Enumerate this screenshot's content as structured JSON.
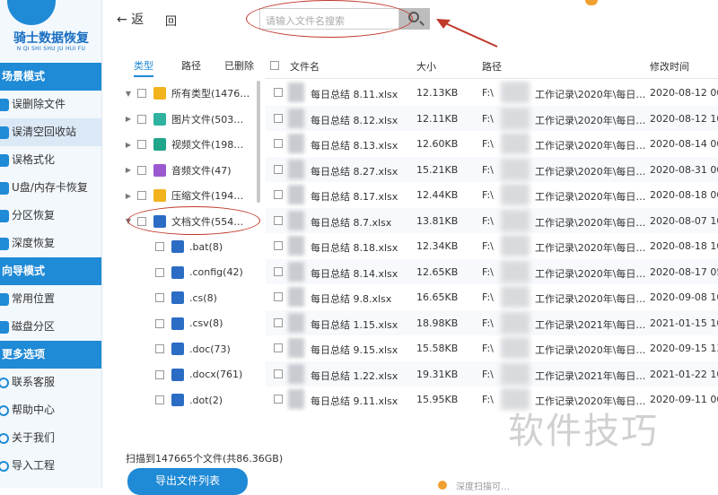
{
  "sidebar": {
    "app_title": "骑士数据恢复",
    "app_subtitle": "N QI SHI SHU JU HUI FU",
    "sections": [
      {
        "title": "场景模式",
        "items": [
          "误删除文件",
          "误清空回收站",
          "误格式化",
          "U盘/内存卡恢复",
          "分区恢复",
          "深度恢复"
        ]
      },
      {
        "title": "向导模式",
        "items": [
          "常用位置",
          "磁盘分区"
        ]
      },
      {
        "title": "更多选项",
        "items": [
          "联系客服",
          "帮助中心",
          "关于我们",
          "导入工程"
        ]
      }
    ]
  },
  "topbar": {
    "back_label": "← 返",
    "home_label": "回",
    "search_placeholder": "请输入文件名搜索"
  },
  "tree": {
    "tabs": [
      "类型",
      "路径",
      "已删除"
    ],
    "rows": [
      {
        "label": "所有类型(1476…",
        "color": "#f3b31f"
      },
      {
        "label": "图片文件(503…",
        "color": "#2fb3a0"
      },
      {
        "label": "视频文件(198…",
        "color": "#1fa68a"
      },
      {
        "label": "音频文件(47)",
        "color": "#9b59d0"
      },
      {
        "label": "压缩文件(194…",
        "color": "#f3b31f"
      },
      {
        "label": "文档文件(554…",
        "color": "#2b6cc4"
      },
      {
        "label": ".bat(8)",
        "color": "#2b6cc4"
      },
      {
        "label": ".config(42)",
        "color": "#2b6cc4"
      },
      {
        "label": ".cs(8)",
        "color": "#2b6cc4"
      },
      {
        "label": ".csv(8)",
        "color": "#2b6cc4"
      },
      {
        "label": ".doc(73)",
        "color": "#2b6cc4"
      },
      {
        "label": ".docx(761)",
        "color": "#2b6cc4"
      },
      {
        "label": ".dot(2)",
        "color": "#2b6cc4"
      }
    ],
    "scan_info": "扫描到147665个文件(共86.36GB)",
    "export_label": "导出文件列表"
  },
  "table": {
    "headers": {
      "name": "文件名",
      "size": "大小",
      "path": "路径",
      "modified": "修改时间"
    },
    "rows": [
      {
        "name": "每日总结 8.11.xlsx",
        "size": "12.13KB",
        "path": "工作记录\\2020年\\每日…",
        "time": "2020-08-12 00"
      },
      {
        "name": "每日总结 8.12.xlsx",
        "size": "12.11KB",
        "path": "工作记录\\2020年\\每日…",
        "time": "2020-08-12 10"
      },
      {
        "name": "每日总结 8.13.xlsx",
        "size": "12.60KB",
        "path": "工作记录\\2020年\\每日…",
        "time": "2020-08-14 00"
      },
      {
        "name": "每日总结 8.27.xlsx",
        "size": "15.21KB",
        "path": "工作记录\\2020年\\每日…",
        "time": "2020-08-31 00"
      },
      {
        "name": "每日总结 8.17.xlsx",
        "size": "12.44KB",
        "path": "工作记录\\2020年\\每日…",
        "time": "2020-08-18 00"
      },
      {
        "name": "每日总结 8.7.xlsx",
        "size": "13.81KB",
        "path": "工作记录\\2020年\\每日…",
        "time": "2020-08-07 10"
      },
      {
        "name": "每日总结 8.18.xlsx",
        "size": "12.34KB",
        "path": "工作记录\\2020年\\每日…",
        "time": "2020-08-18 10"
      },
      {
        "name": "每日总结 8.14.xlsx",
        "size": "12.65KB",
        "path": "工作记录\\2020年\\每日…",
        "time": "2020-08-17 05"
      },
      {
        "name": "每日总结 9.8.xlsx",
        "size": "16.65KB",
        "path": "工作记录\\2020年\\每日…",
        "time": "2020-09-08 10"
      },
      {
        "name": "每日总结 1.15.xlsx",
        "size": "18.98KB",
        "path": "工作记录\\2021年\\每日…",
        "time": "2021-01-15 10"
      },
      {
        "name": "每日总结 9.15.xlsx",
        "size": "15.58KB",
        "path": "工作记录\\2020年\\每日…",
        "time": "2020-09-15 13"
      },
      {
        "name": "每日总结 1.22.xlsx",
        "size": "19.31KB",
        "path": "工作记录\\2021年\\每日…",
        "time": "2021-01-22 10"
      },
      {
        "name": "每日总结 9.11.xlsx",
        "size": "15.95KB",
        "path": "工作记录\\2020年\\每日…",
        "time": "2020-09-11 00"
      }
    ],
    "path_prefix": "F:\\"
  },
  "watermark": "软件技巧",
  "bottom_hint": "深度扫描可…"
}
